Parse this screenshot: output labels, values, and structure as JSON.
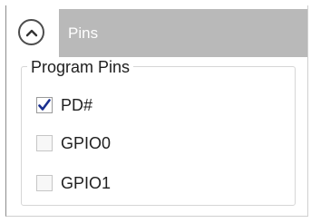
{
  "pins_panel": {
    "title": "Pins",
    "collapse_icon": "chevron-up-icon",
    "group_label": "Program Pins",
    "pins": [
      {
        "label": "PD#",
        "checked": true
      },
      {
        "label": "GPIO0",
        "checked": false
      },
      {
        "label": "GPIO1",
        "checked": false
      }
    ]
  },
  "colors": {
    "header_bar": "#b9b9b9",
    "check_mark": "#1a2f8f"
  }
}
